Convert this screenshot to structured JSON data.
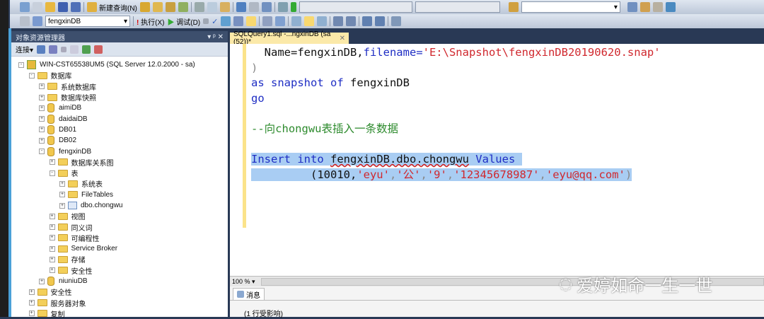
{
  "toolbar": {
    "new_query": "新建查询(N)",
    "database": "fengxinDB",
    "execute": "执行(X)",
    "debug": "调试(D)"
  },
  "object_explorer": {
    "title": "对象资源管理器",
    "connect": "连接",
    "tree": [
      {
        "label": "WIN-CST65538UM5 (SQL Server 12.0.2000 - sa)",
        "level": 0,
        "icon": "server-icon",
        "state": "-"
      },
      {
        "label": "数据库",
        "level": 1,
        "icon": "folder-icon",
        "state": "-"
      },
      {
        "label": "系统数据库",
        "level": 2,
        "icon": "folder-icon",
        "state": "+"
      },
      {
        "label": "数据库快照",
        "level": 2,
        "icon": "folder-icon",
        "state": "+"
      },
      {
        "label": "aimiDB",
        "level": 2,
        "icon": "database-icon",
        "state": "+"
      },
      {
        "label": "daidaiDB",
        "level": 2,
        "icon": "database-icon",
        "state": "+"
      },
      {
        "label": "DB01",
        "level": 2,
        "icon": "database-icon",
        "state": "+"
      },
      {
        "label": "DB02",
        "level": 2,
        "icon": "database-icon",
        "state": "+"
      },
      {
        "label": "fengxinDB",
        "level": 2,
        "icon": "database-icon",
        "state": "-"
      },
      {
        "label": "数据库关系图",
        "level": 3,
        "icon": "folder-icon",
        "state": "+"
      },
      {
        "label": "表",
        "level": 3,
        "icon": "folder-icon",
        "state": "-"
      },
      {
        "label": "系统表",
        "level": 4,
        "icon": "folder-icon",
        "state": "+"
      },
      {
        "label": "FileTables",
        "level": 4,
        "icon": "folder-icon",
        "state": "+"
      },
      {
        "label": "dbo.chongwu",
        "level": 4,
        "icon": "table-icon",
        "state": "+"
      },
      {
        "label": "视图",
        "level": 3,
        "icon": "folder-icon",
        "state": "+"
      },
      {
        "label": "同义词",
        "level": 3,
        "icon": "folder-icon",
        "state": "+"
      },
      {
        "label": "可编程性",
        "level": 3,
        "icon": "folder-icon",
        "state": "+"
      },
      {
        "label": "Service Broker",
        "level": 3,
        "icon": "folder-icon",
        "state": "+"
      },
      {
        "label": "存储",
        "level": 3,
        "icon": "folder-icon",
        "state": "+"
      },
      {
        "label": "安全性",
        "level": 3,
        "icon": "folder-icon",
        "state": "+"
      },
      {
        "label": "niuniuDB",
        "level": 2,
        "icon": "database-icon",
        "state": "+"
      },
      {
        "label": "安全性",
        "level": 1,
        "icon": "folder-icon",
        "state": "+"
      },
      {
        "label": "服务器对象",
        "level": 1,
        "icon": "folder-icon",
        "state": "+"
      },
      {
        "label": "复制",
        "level": 1,
        "icon": "folder-icon",
        "state": "+"
      }
    ]
  },
  "editor": {
    "tab_label": "SQLQuery1.sql -...ngxinDB (sa (52))*",
    "l1a": "  Name=fengxinDB,",
    "l1b": "filename=",
    "l1c": "'E:\\Snapshot\\fengxinDB20190620.snap'",
    "l2": ")",
    "l3a": "as snapshot of",
    "l3b": " fengxinDB",
    "l4": "go",
    "l6": "--向chongwu表插入一条数据",
    "l8a": "Insert into",
    "l8b": "fengxinDB.dbo.chongwu",
    "l8c": " Values ",
    "l9a": "         (10010,",
    "l9b": "'eyu'",
    "l9c": "'公'",
    "l9d": "'9'",
    "l9e": "'12345678987'",
    "l9f": "'eyu@qq.com'",
    "l9g": ")",
    "comma": ","
  },
  "zoom": "100 %",
  "results": {
    "tab": "消息",
    "message": "(1 行受影响)"
  },
  "watermark": "爱婷如命一生一世"
}
